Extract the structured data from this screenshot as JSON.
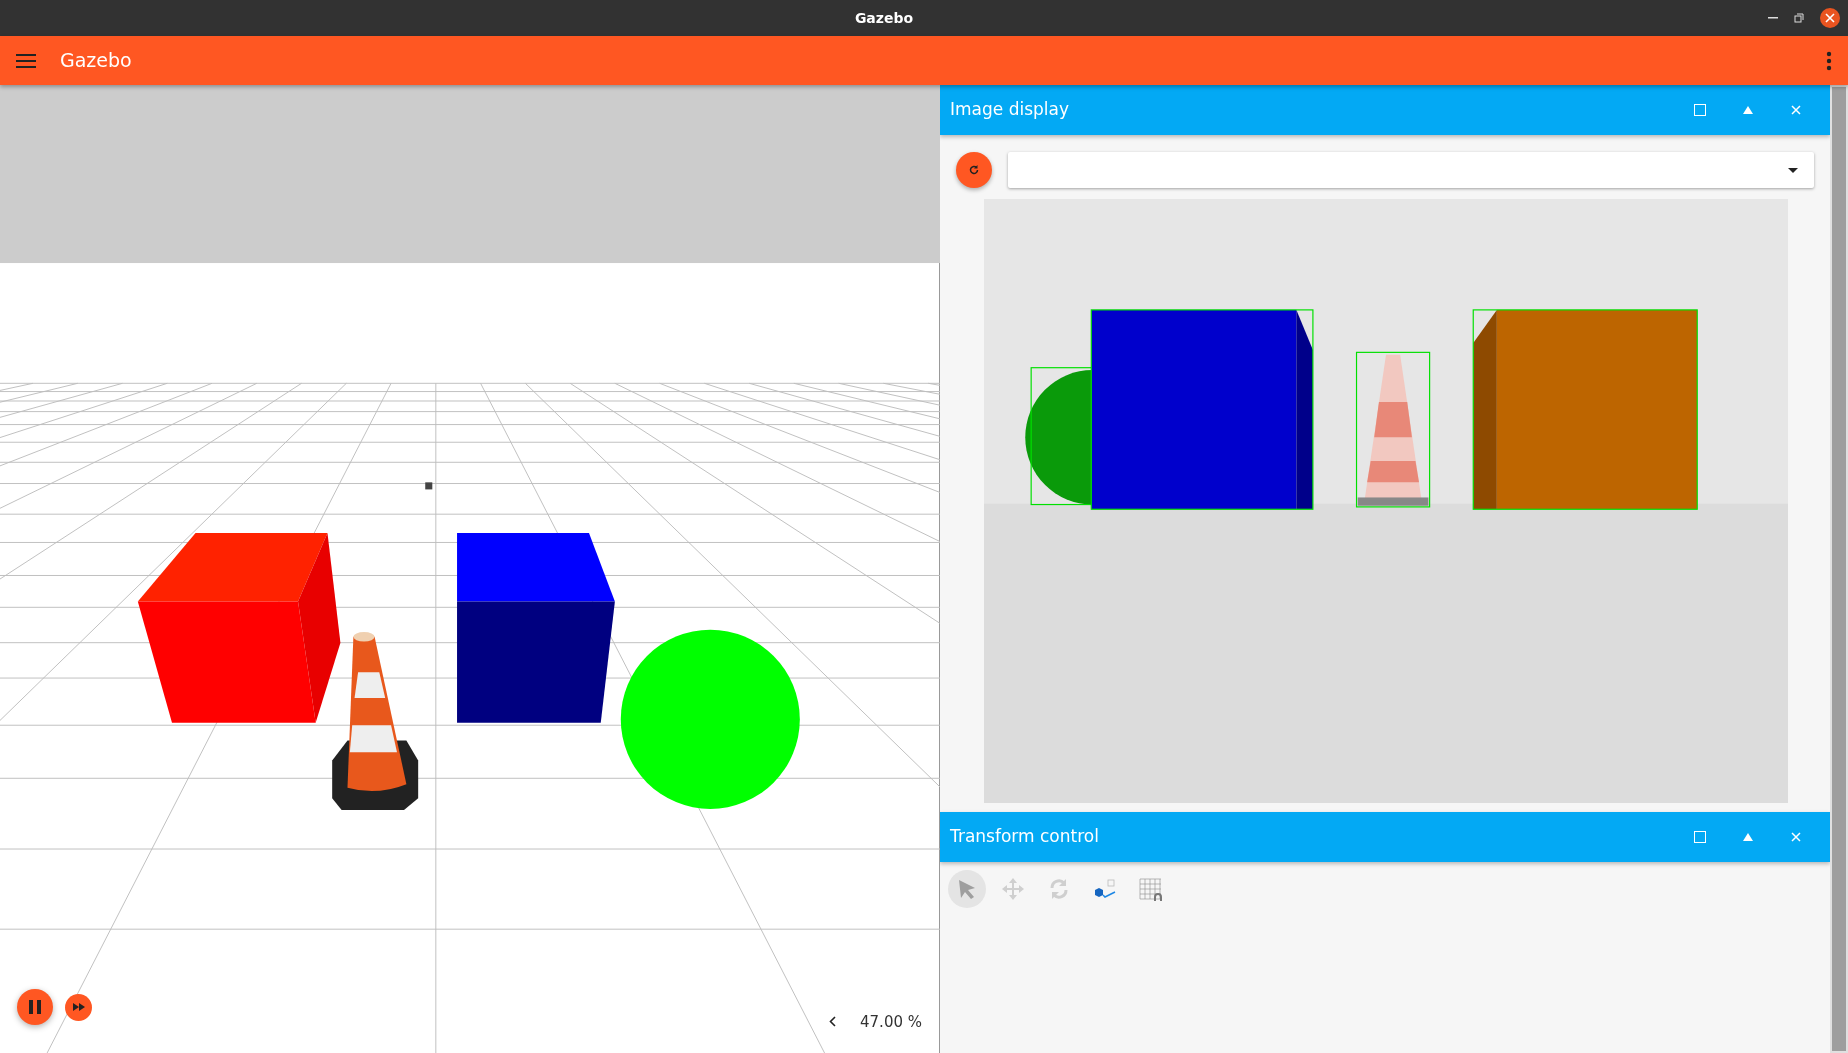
{
  "window": {
    "title": "Gazebo"
  },
  "app_bar": {
    "title": "Gazebo"
  },
  "scene": {
    "zoom_readout": "47.00 %"
  },
  "image_display": {
    "title": "Image display"
  },
  "transform_control": {
    "title": "Transform control",
    "tools": [
      {
        "kind": "select",
        "selected": true
      },
      {
        "kind": "translate",
        "selected": false
      },
      {
        "kind": "rotate",
        "selected": false
      },
      {
        "kind": "view-angle",
        "selected": false
      },
      {
        "kind": "snap",
        "selected": false
      }
    ]
  }
}
